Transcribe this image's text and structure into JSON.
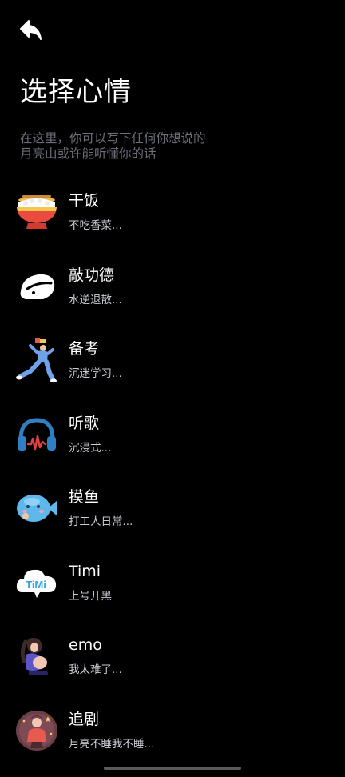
{
  "header": {
    "back_icon": "back-arrow-icon",
    "title": "选择心情",
    "subtitle_line1": "在这里，你可以写下任何你想说的",
    "subtitle_line2": "月亮山或许能听懂你的话"
  },
  "moods": [
    {
      "name": "干饭",
      "desc": "不吃香菜...",
      "icon": "rice-bowl-icon"
    },
    {
      "name": "敲功德",
      "desc": "水逆退散...",
      "icon": "wooden-fish-icon"
    },
    {
      "name": "备考",
      "desc": "沉迷学习...",
      "icon": "student-icon"
    },
    {
      "name": "听歌",
      "desc": "沉浸式...",
      "icon": "headphones-icon"
    },
    {
      "name": "摸鱼",
      "desc": "打工人日常...",
      "icon": "fish-icon"
    },
    {
      "name": "Timi",
      "desc": "上号开黑",
      "icon": "timi-cloud-icon",
      "icon_text": "TiMi"
    },
    {
      "name": "emo",
      "desc": "我太难了...",
      "icon": "sad-girl-icon"
    },
    {
      "name": "追剧",
      "desc": "月亮不睡我不睡...",
      "icon": "tv-watching-icon"
    }
  ],
  "colors": {
    "background": "#000000",
    "subtitle": "#6d6f7a",
    "desc": "#c9cbd3"
  }
}
